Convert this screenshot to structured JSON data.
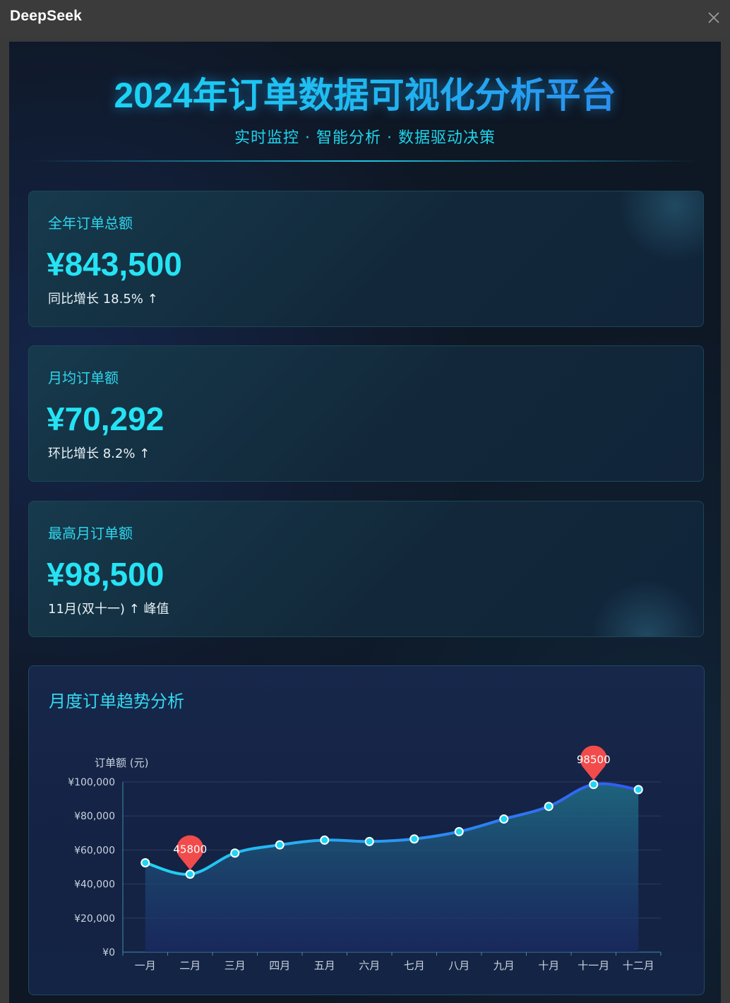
{
  "window": {
    "title": "DeepSeek"
  },
  "header": {
    "title": "2024年订单数据可视化分析平台",
    "subtitle": "实时监控 · 智能分析 · 数据驱动决策"
  },
  "cards": [
    {
      "label": "全年订单总额",
      "value": "¥843,500",
      "note": "同比增长 18.5% ↑"
    },
    {
      "label": "月均订单额",
      "value": "¥70,292",
      "note": "环比增长 8.2% ↑"
    },
    {
      "label": "最高月订单额",
      "value": "¥98,500",
      "note": "11月(双十一) ↑ 峰值"
    }
  ],
  "chart_panel": {
    "title": "月度订单趋势分析"
  },
  "chart_data": {
    "type": "line",
    "ylabel": "订单额 (元)",
    "categories": [
      "一月",
      "二月",
      "三月",
      "四月",
      "五月",
      "六月",
      "七月",
      "八月",
      "九月",
      "十月",
      "十一月",
      "十二月"
    ],
    "values": [
      52500,
      45800,
      58200,
      63000,
      65800,
      65000,
      66500,
      70800,
      78200,
      85600,
      98500,
      95500
    ],
    "ylim": [
      0,
      100000
    ],
    "yticks": [
      0,
      20000,
      40000,
      60000,
      80000,
      100000
    ],
    "ytick_labels": [
      "¥0",
      "¥20,000",
      "¥40,000",
      "¥60,000",
      "¥80,000",
      "¥100,000"
    ],
    "markers": [
      {
        "category": "二月",
        "label": "45800"
      },
      {
        "category": "十一月",
        "label": "98500"
      }
    ],
    "grid": true,
    "area_fill": true,
    "colors": {
      "line_start": "#1fd6f2",
      "line_end": "#3358f5",
      "marker": "#f24b4b"
    }
  }
}
